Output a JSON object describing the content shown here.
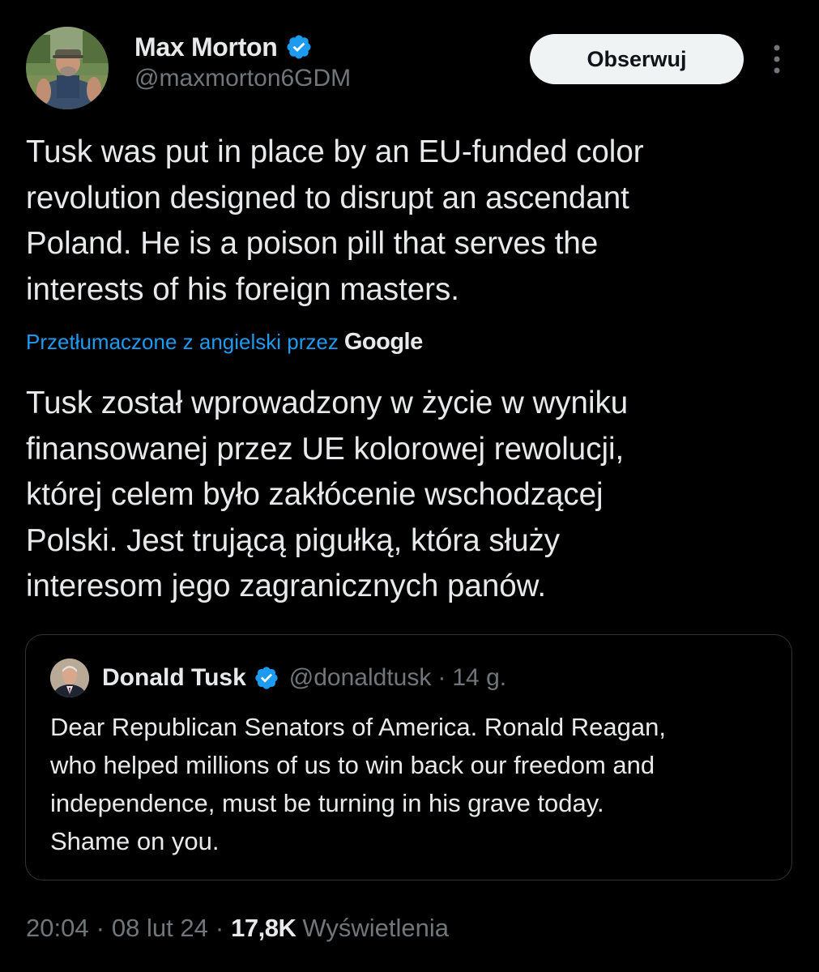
{
  "author": {
    "name": "Max Morton",
    "handle": "@maxmorton6GDM",
    "verified_color": "#1d9bf0"
  },
  "actions": {
    "follow_label": "Obserwuj",
    "more_icon": "more-vertical-icon"
  },
  "tweet": {
    "text_lines": [
      "Tusk was put in place by an EU-funded color",
      "revolution designed to disrupt an ascendant",
      "Poland. He is a poison pill that serves the",
      "interests of his foreign masters."
    ]
  },
  "translation": {
    "label": "Przetłumaczone z angielski przez",
    "provider": "Google",
    "text_lines": [
      "Tusk został wprowadzony w życie w wyniku",
      "finansowanej przez UE kolorowej rewolucji,",
      "której celem było zakłócenie wschodzącej",
      "Polski. Jest trującą pigułką, która służy",
      "interesom jego zagranicznych panów."
    ]
  },
  "quote": {
    "name": "Donald Tusk",
    "handle": "@donaldtusk",
    "separator": "·",
    "time": "14 g.",
    "text_lines": [
      "Dear Republican Senators of America. Ronald Reagan,",
      "who helped millions of us to win back our freedom and",
      "independence, must be turning in his grave today.",
      "Shame on you."
    ]
  },
  "meta": {
    "time": "20:04",
    "separator": "·",
    "date": "08 lut 24",
    "views_count": "17,8K",
    "views_label": "Wyświetlenia"
  },
  "colors": {
    "background": "#000000",
    "text": "#e7e9ea",
    "muted": "#71767b",
    "accent": "#1d9bf0",
    "border": "#2f3336"
  }
}
